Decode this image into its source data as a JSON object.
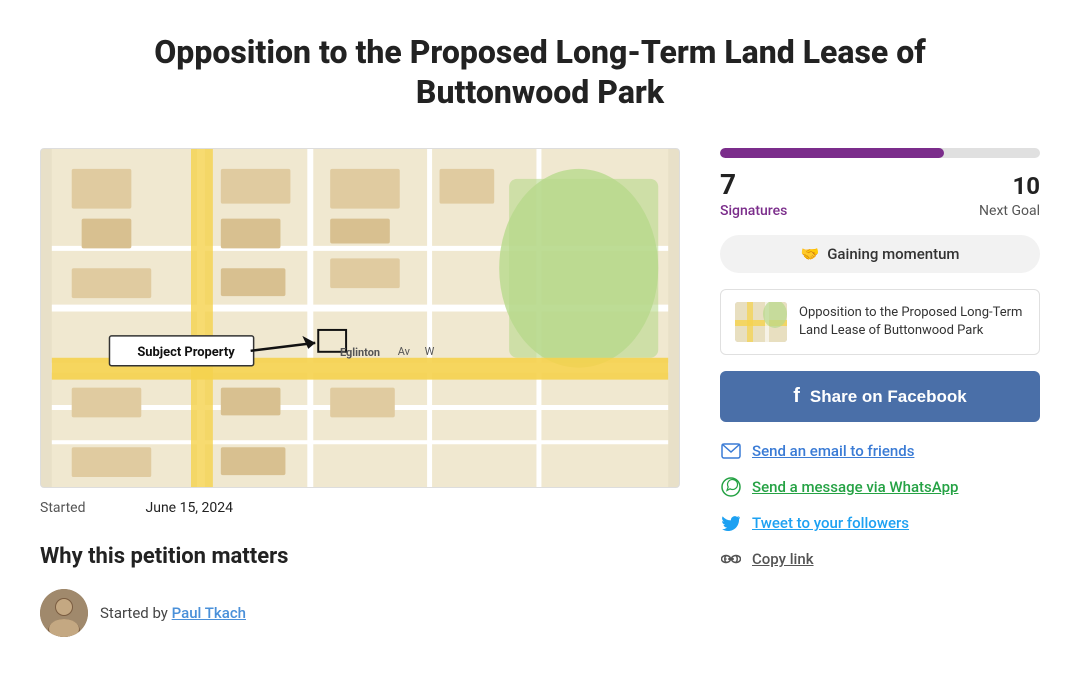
{
  "page": {
    "title": "Opposition to the Proposed Long-Term Land Lease of Buttonwood Park"
  },
  "progress": {
    "signatures": 7,
    "goal": 10,
    "sig_label": "Signatures",
    "goal_label": "Next Goal",
    "percent": 70,
    "momentum_text": "Gaining momentum"
  },
  "petition_card": {
    "text": "Opposition to the Proposed Long-Term Land Lease of Buttonwood Park"
  },
  "facebook_btn": {
    "label": "Share on Facebook"
  },
  "action_links": {
    "email": "Send an email to friends",
    "whatsapp": "Send a message via WhatsApp",
    "twitter": "Tweet to your followers",
    "copy": "Copy link"
  },
  "started": {
    "label": "Started",
    "date": "June 15, 2024"
  },
  "petition_matters": {
    "heading": "Why this petition matters"
  },
  "author": {
    "started_by": "Started by",
    "name": "Paul Tkach"
  }
}
